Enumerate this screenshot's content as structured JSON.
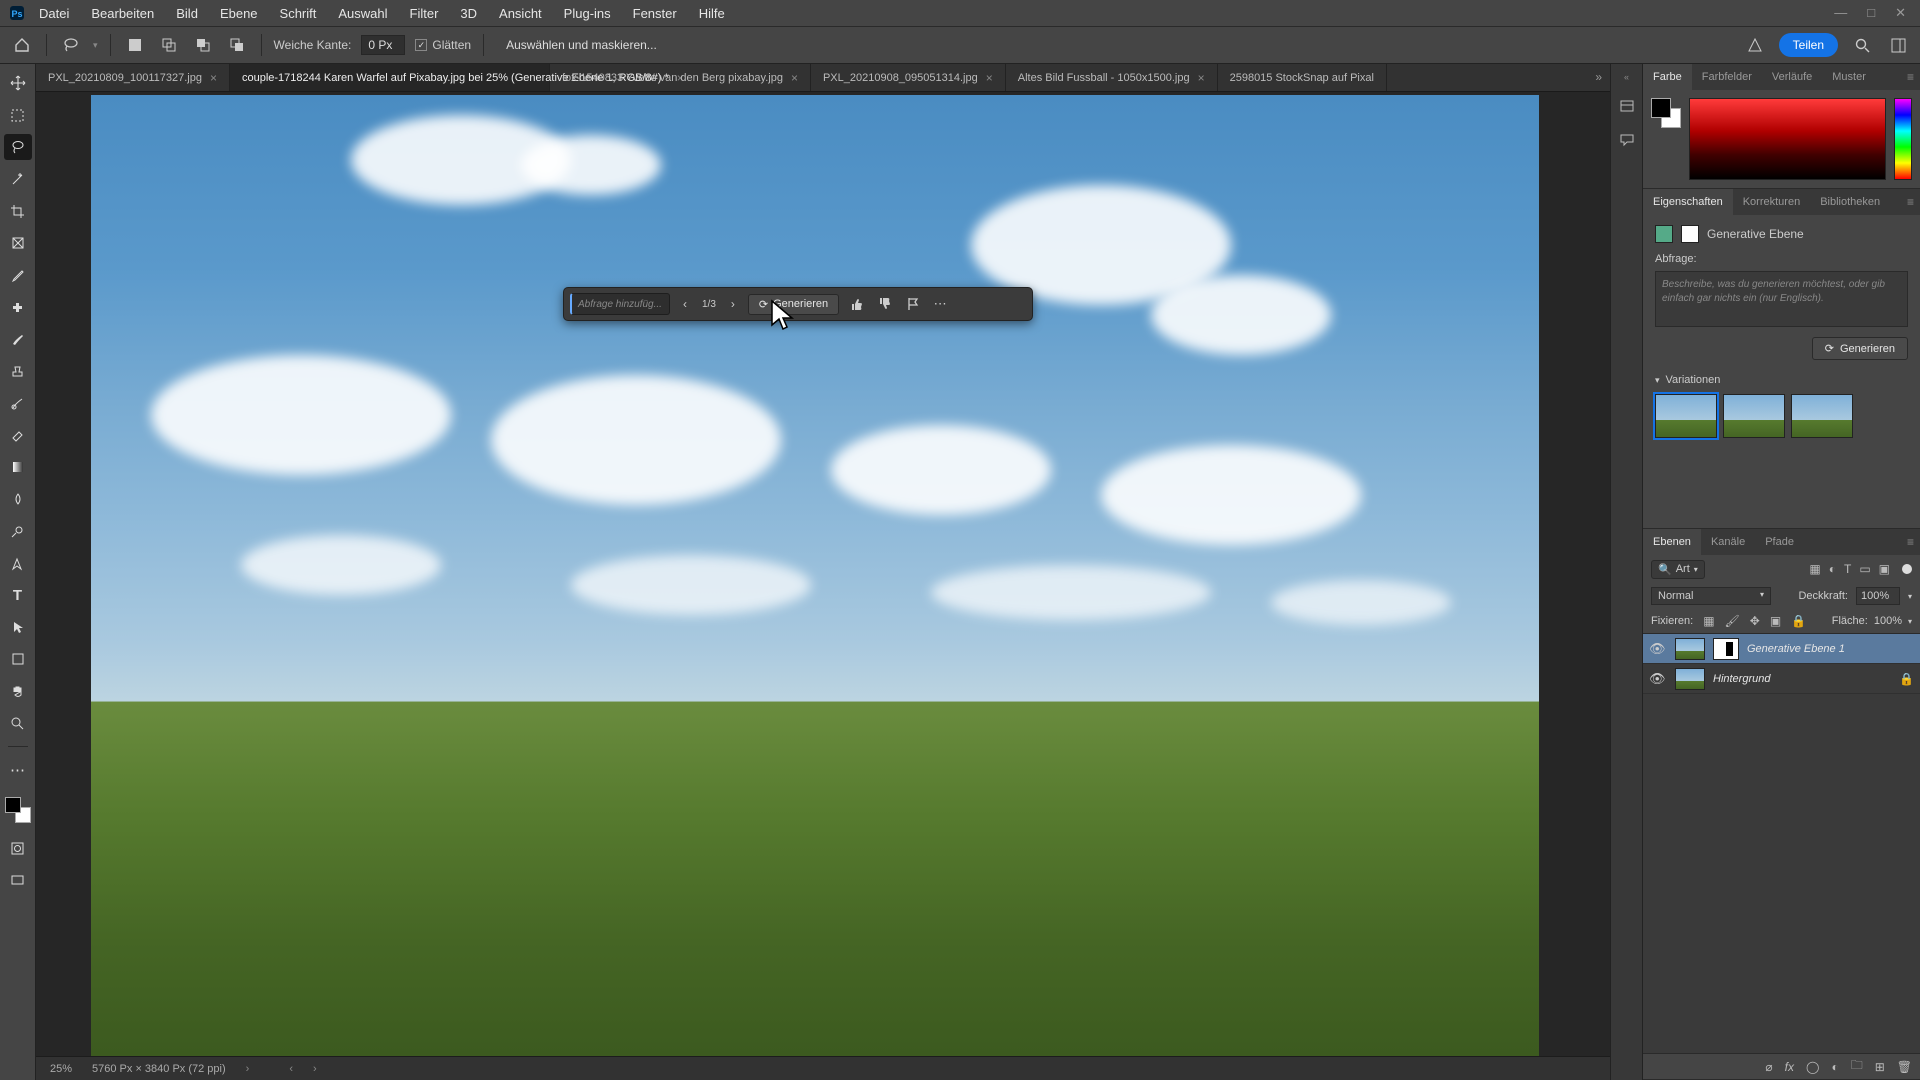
{
  "menubar": {
    "items": [
      "Datei",
      "Bearbeiten",
      "Bild",
      "Ebene",
      "Schrift",
      "Auswahl",
      "Filter",
      "3D",
      "Ansicht",
      "Plug-ins",
      "Fenster",
      "Hilfe"
    ]
  },
  "optionsbar": {
    "feather_label": "Weiche Kante:",
    "feather_value": "0 Px",
    "antialias_label": "Glätten",
    "selectmask_label": "Auswählen und maskieren...",
    "share_label": "Teilen"
  },
  "tabs": [
    {
      "label": "PXL_20210809_100117327.jpg"
    },
    {
      "label": "couple-1718244 Karen Warfel auf Pixabay.jpg bei 25% (Generative Ebene 1, RGB/8#) *",
      "active": true
    },
    {
      "label": "fox-1540833 Yvette van den Berg pixabay.jpg"
    },
    {
      "label": "PXL_20210908_095051314.jpg"
    },
    {
      "label": "Altes Bild Fussball - 1050x1500.jpg"
    },
    {
      "label": "2598015 StockSnap auf Pixal"
    }
  ],
  "genbar": {
    "prompt_placeholder": "Abfrage hinzufüg...",
    "counter": "1/3",
    "generate_label": "Generieren"
  },
  "statusbar": {
    "zoom": "25%",
    "docinfo": "5760 Px × 3840 Px (72 ppi)"
  },
  "color_panel": {
    "tabs": [
      "Farbe",
      "Farbfelder",
      "Verläufe",
      "Muster"
    ]
  },
  "properties_panel": {
    "tabs": [
      "Eigenschaften",
      "Korrekturen",
      "Bibliotheken"
    ],
    "layer_type": "Generative Ebene",
    "prompt_label": "Abfrage:",
    "prompt_placeholder": "Beschreibe, was du generieren möchtest, oder gib einfach gar nichts ein (nur Englisch).",
    "generate_label": "Generieren",
    "variations_label": "Variationen"
  },
  "layers_panel": {
    "tabs": [
      "Ebenen",
      "Kanäle",
      "Pfade"
    ],
    "filter_label": "Art",
    "blend_mode": "Normal",
    "opacity_label": "Deckkraft:",
    "opacity_value": "100%",
    "lock_label": "Fixieren:",
    "fill_label": "Fläche:",
    "fill_value": "100%",
    "layers": [
      {
        "name": "Generative Ebene 1",
        "selected": true,
        "masked": true
      },
      {
        "name": "Hintergrund",
        "locked": true
      }
    ]
  }
}
